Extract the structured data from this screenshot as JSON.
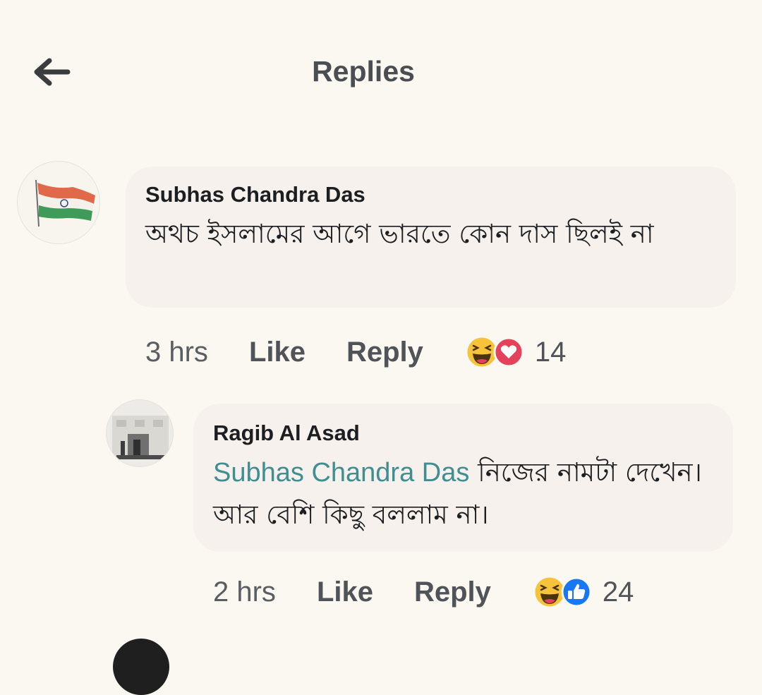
{
  "header": {
    "title": "Replies",
    "back_icon": "arrow-left-icon"
  },
  "comments": [
    {
      "author": "Subhas Chandra Das",
      "avatar": "india-flag-avatar",
      "text": "অথচ ইসলামের আগে ভারতে কোন দাস ছিলই না",
      "time": "3 hrs",
      "like_label": "Like",
      "reply_label": "Reply",
      "reactions": [
        "haha-icon",
        "love-icon"
      ],
      "reaction_count": "14"
    },
    {
      "author": "Ragib Al Asad",
      "avatar": "building-avatar",
      "mention": "Subhas Chandra Das",
      "text": "নিজের নামটা দেখেন। আর বেশি কিছু বললাম না।",
      "time": "2 hrs",
      "like_label": "Like",
      "reply_label": "Reply",
      "reactions": [
        "haha-icon",
        "like-icon"
      ],
      "reaction_count": "24"
    }
  ],
  "colors": {
    "background": "#fbf8f1",
    "bubble": "#f6f1ec",
    "mention": "#3f8f92",
    "love": "#e4415a",
    "like": "#1877f2",
    "haha": "#f7c33b"
  }
}
